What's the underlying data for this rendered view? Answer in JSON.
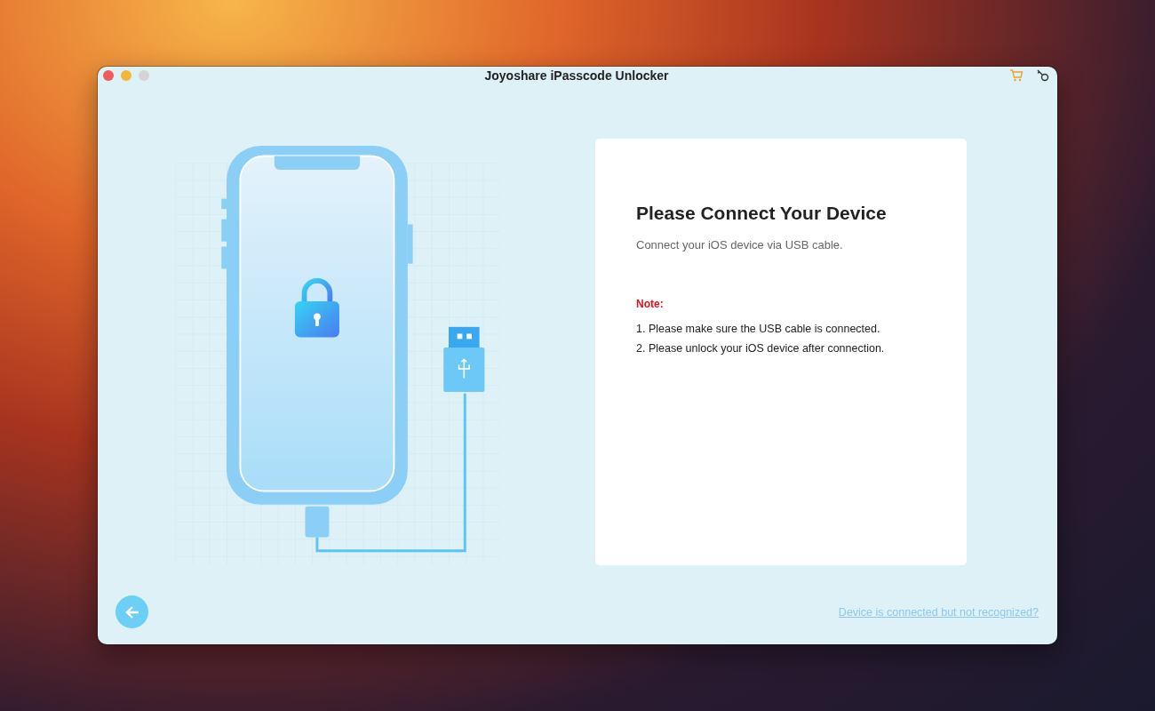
{
  "window": {
    "title": "Joyoshare iPasscode Unlocker",
    "controls": [
      {
        "kind": "close",
        "disabled": false
      },
      {
        "kind": "minimize",
        "disabled": false
      },
      {
        "kind": "zoom",
        "disabled": true
      }
    ]
  },
  "card": {
    "heading": "Please Connect Your Device",
    "subtitle": "Connect your iOS device via USB cable.",
    "note_label": "Note:",
    "notes": [
      "1. Please make sure the USB cable is connected.",
      "2. Please unlock your iOS device after connection."
    ]
  },
  "footer": {
    "help_link": "Device is connected but not recognized?"
  }
}
